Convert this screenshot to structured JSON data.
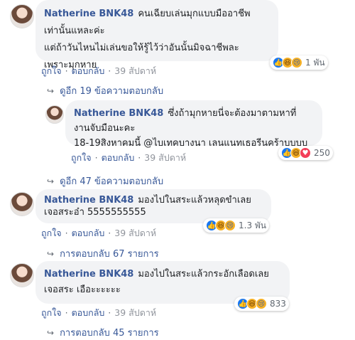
{
  "labels": {
    "like": "ถูกใจ",
    "reply": "ตอบกลับ",
    "sep": "·"
  },
  "comments": [
    {
      "author": "Natherine BNK48",
      "text": "คนเฉียบเล่นมุกแบบมืออาชีพเท่านั้นแหละค่ะ\nแต่ถ้าวันไหนไม่เล่นขอให้รู้ไว้ว่าอันนั้นมิจฉาชีพละ\nเพราะมุกหาย",
      "time": "39 สัปดาห์",
      "reactions_count": "1 พัน",
      "replies_link": "ดูอีก 19 ข้อความตอบกลับ"
    },
    {
      "author": "Natherine BNK48",
      "text": "ซึ่งถ้ามุกหายนี่จะต้องมาตามหาที่\nงานจับมือนะคะ\n18-19สิงหาคมนี้ @ไบเทคบางนา เลนแนทเธอรีนคร้าบบบบ",
      "time": "39 สัปดาห์",
      "reactions_count": "250",
      "replies_link": "ดูอีก 47 ข้อความตอบกลับ"
    },
    {
      "author": "Natherine BNK48",
      "text": "มองไปในสระแล้วหลุดขำเลย\nเจอสระอ๋า 5555555555",
      "time": "39 สัปดาห์",
      "reactions_count": "1.3 พัน",
      "replies_link": "การตอบกลับ 67 รายการ"
    },
    {
      "author": "Natherine BNK48",
      "text": "มองไปในสระแล้วกระอักเลือดเลย\nเจอสระ เอือะะะะะะ",
      "time": "39 สัปดาห์",
      "reactions_count": "833",
      "replies_link": "การตอบกลับ 45 รายการ"
    }
  ],
  "icons": {
    "like": "👍",
    "haha": "😆",
    "sad": "😢",
    "love": "♥",
    "reply_arrow": "↪"
  },
  "colors": {
    "author": "#385898",
    "bubble": "#f2f3f5",
    "like": "#1877f2",
    "love": "#f33e58"
  }
}
